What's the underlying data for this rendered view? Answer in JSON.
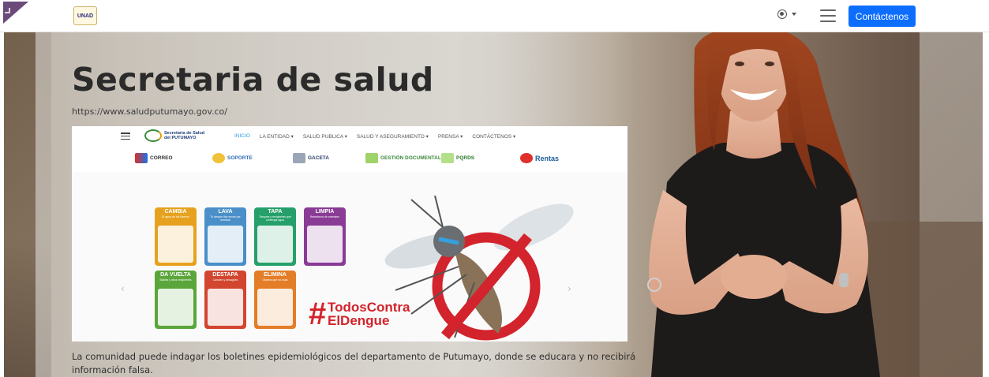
{
  "header": {
    "logo_text": "UNAD",
    "contact_button": "Contáctenos"
  },
  "hero": {
    "title": "Secretaria de salud",
    "url": "https://www.saludputumayo.gov.co/",
    "description": "La comunidad puede indagar los boletines epidemiológicos del departamento de Putumayo, donde se educara y no recibirá información falsa."
  },
  "embedded_site": {
    "logo_line1": "Secretaria de Salud",
    "logo_line2": "del PUTUMAYO",
    "menu": [
      "INICIO",
      "LA ENTIDAD ▾",
      "SALUD PUBLICA ▾",
      "SALUD Y ASEGURAMIENTO ▾",
      "PRENSA ▾",
      "CONTÁCTENOS ▾"
    ],
    "links": [
      "CORREO",
      "SOPORTE",
      "GACETA",
      "GESTIÓN DOCUMENTAL",
      "PQRDS",
      "Rentas"
    ],
    "tiles": [
      {
        "title": "CAMBIA",
        "sub": "El agua de los floreros",
        "color": "#e6a21f"
      },
      {
        "title": "LAVA",
        "sub": "Tu tanque dos veces por semana",
        "color": "#4a8fc8"
      },
      {
        "title": "TAPA",
        "sub": "Tanques y recipientes que contenga agua",
        "color": "#26a06a"
      },
      {
        "title": "LIMPIA",
        "sub": "Bebederos de animales",
        "color": "#8a3b96"
      },
      {
        "title": "DA VUELTA",
        "sub": "Baldes y otros recipientes",
        "color": "#5aa63a"
      },
      {
        "title": "DESTAPA",
        "sub": "Canales y desagües",
        "color": "#d2452e"
      },
      {
        "title": "ELIMINA",
        "sub": "Objetos que no usas",
        "color": "#e47d27"
      }
    ],
    "hashtag_line1": "TodosContra",
    "hashtag_line2": "ElDengue"
  },
  "colors": {
    "primary_button": "#0d6efd",
    "hashtag_red": "#d3232c"
  }
}
